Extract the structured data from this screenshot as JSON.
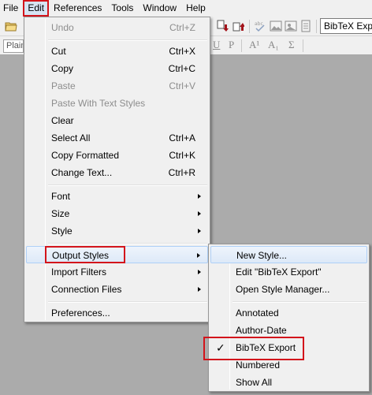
{
  "menubar": {
    "items": [
      "File",
      "Edit",
      "References",
      "Tools",
      "Window",
      "Help"
    ]
  },
  "toolbar": {
    "style_value": "Plain",
    "output_style_value": "BibTeX Export",
    "format_buttons": [
      "U",
      "P",
      "A¹",
      "A₁",
      "Σ"
    ]
  },
  "edit_menu": {
    "undo": {
      "label": "Undo",
      "shortcut": "Ctrl+Z"
    },
    "cut": {
      "label": "Cut",
      "shortcut": "Ctrl+X"
    },
    "copy": {
      "label": "Copy",
      "shortcut": "Ctrl+C"
    },
    "paste": {
      "label": "Paste",
      "shortcut": "Ctrl+V"
    },
    "paste_styles": {
      "label": "Paste With Text Styles"
    },
    "clear": {
      "label": "Clear"
    },
    "select_all": {
      "label": "Select All",
      "shortcut": "Ctrl+A"
    },
    "copy_formatted": {
      "label": "Copy Formatted",
      "shortcut": "Ctrl+K"
    },
    "change_text": {
      "label": "Change Text...",
      "shortcut": "Ctrl+R"
    },
    "font": {
      "label": "Font"
    },
    "size": {
      "label": "Size"
    },
    "style": {
      "label": "Style"
    },
    "output_styles": {
      "label": "Output Styles"
    },
    "import_filters": {
      "label": "Import Filters"
    },
    "connection_files": {
      "label": "Connection Files"
    },
    "preferences": {
      "label": "Preferences..."
    }
  },
  "output_styles_menu": {
    "new_style": "New Style...",
    "edit_style": "Edit \"BibTeX Export\"",
    "open_manager": "Open Style Manager...",
    "styles": [
      "Annotated",
      "Author-Date",
      "BibTeX Export",
      "Numbered",
      "Show All"
    ],
    "checked_style": "BibTeX Export"
  },
  "colors": {
    "highlight_box": "#d3141b",
    "menu_bg": "#f0f0f0",
    "workspace_bg": "#ababab"
  }
}
